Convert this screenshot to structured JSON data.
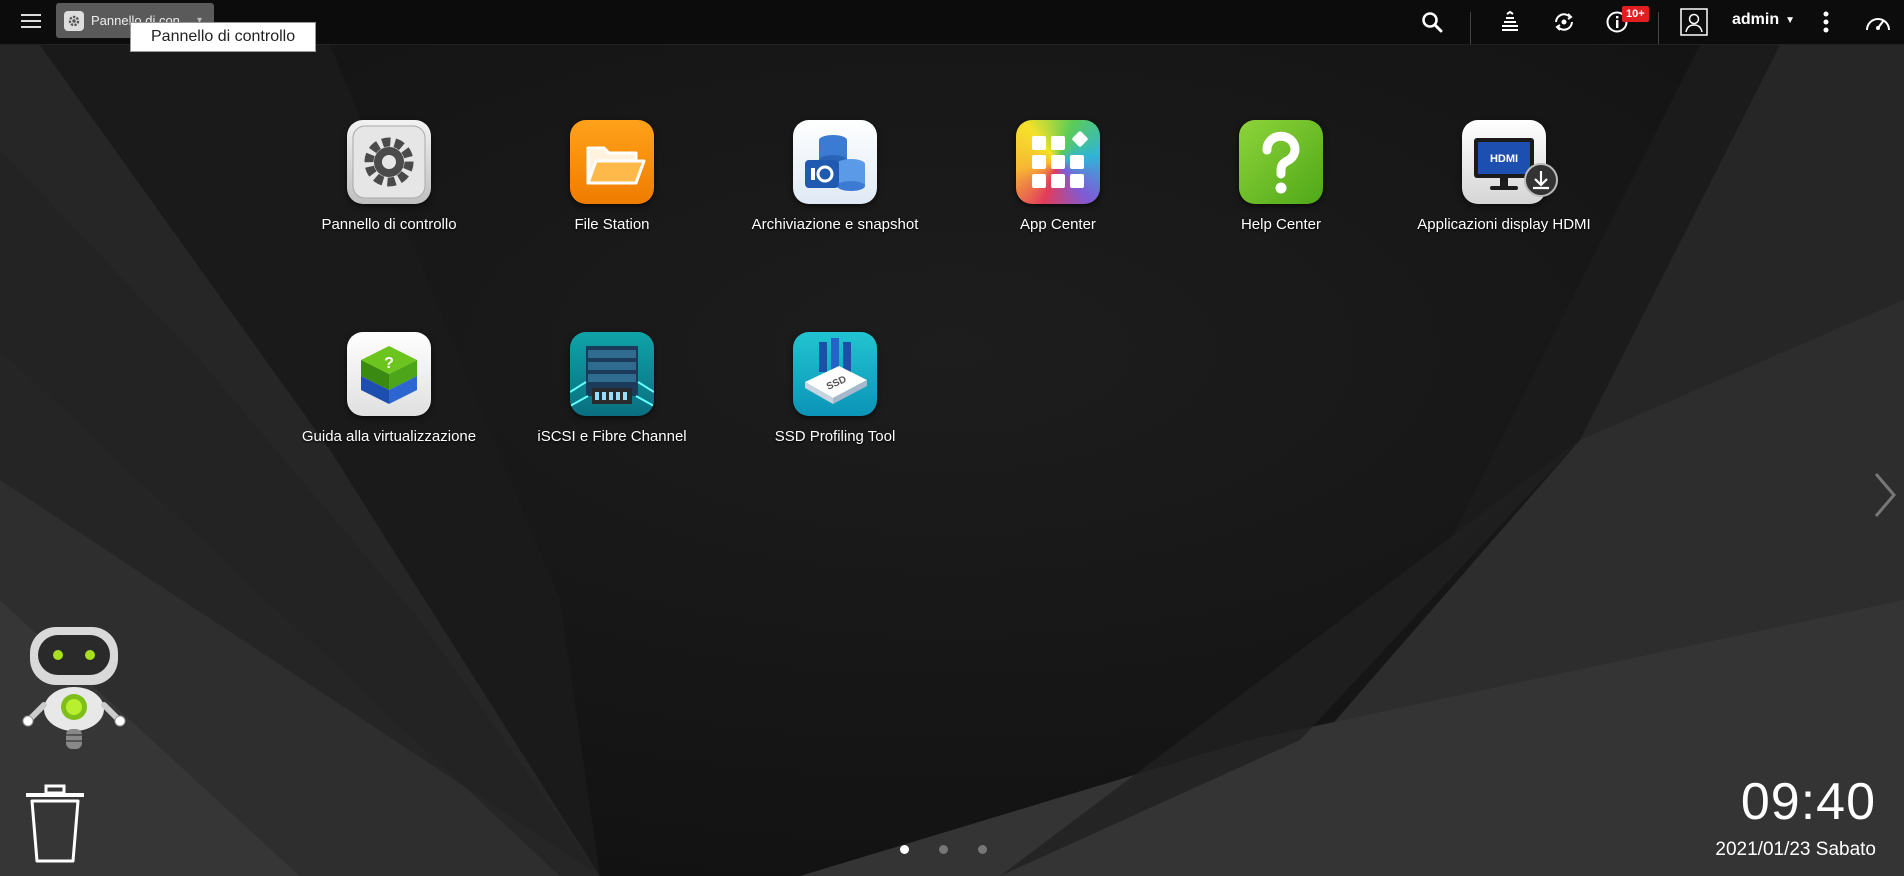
{
  "topbar": {
    "tab_label": "Pannello di con...",
    "tooltip": "Pannello di controllo",
    "notification_badge": "10+",
    "user": "admin"
  },
  "apps": [
    {
      "label": "Pannello di controllo",
      "icon": "gear-icon"
    },
    {
      "label": "File Station",
      "icon": "folder-icon"
    },
    {
      "label": "Archiviazione e snapshot",
      "icon": "storage-icon"
    },
    {
      "label": "App Center",
      "icon": "app-grid-icon"
    },
    {
      "label": "Help Center",
      "icon": "question-icon"
    },
    {
      "label": "Applicazioni display HDMI",
      "icon": "hdmi-monitor-icon"
    },
    {
      "label": "Guida alla virtualizzazione",
      "icon": "virtualization-cube-icon"
    },
    {
      "label": "iSCSI e Fibre Channel",
      "icon": "server-icon"
    },
    {
      "label": "SSD Profiling Tool",
      "icon": "ssd-icon"
    }
  ],
  "hdmi_badge": "HDMI",
  "ssd_badge": "SSD",
  "clock": {
    "time": "09:40",
    "date": "2021/01/23 Sabato"
  },
  "pagination": {
    "pages": 3,
    "current": 1
  },
  "colors": {
    "topbar_bg": "#0c0c0c",
    "badge_red": "#e02020",
    "file_station_orange": "#f28c00",
    "help_green": "#6cc51e"
  }
}
